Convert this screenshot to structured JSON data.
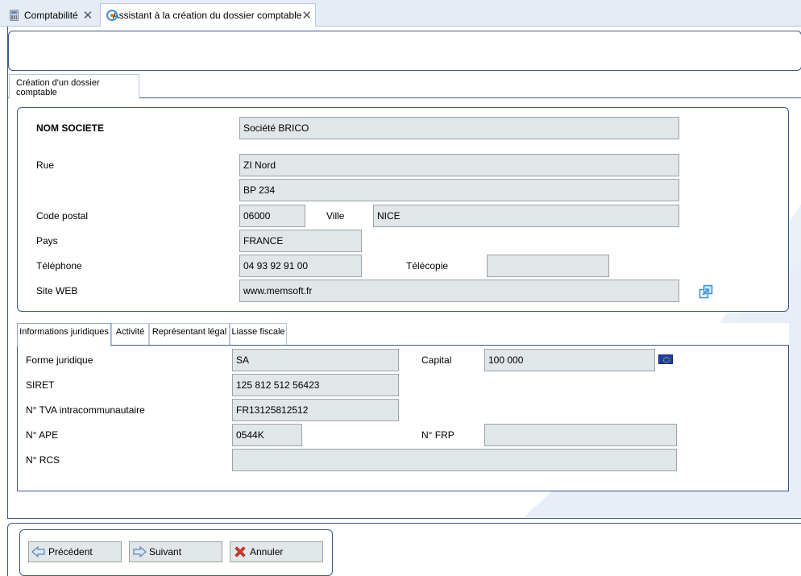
{
  "tabs": [
    {
      "label": "Comptabilité"
    },
    {
      "label": "Assistant à la création du dossier comptable",
      "close": "✕"
    }
  ],
  "section_tab": "Création d'un dossier comptable",
  "company": {
    "name_label": "NOM SOCIETE",
    "name_value": "Société BRICO",
    "rue_label": "Rue",
    "rue1_value": "ZI Nord",
    "rue2_value": "BP 234",
    "cp_label": "Code postal",
    "cp_value": "06000",
    "ville_label": "Ville",
    "ville_value": "NICE",
    "pays_label": "Pays",
    "pays_value": "FRANCE",
    "tel_label": "Téléphone",
    "tel_value": "04 93 92 91 00",
    "fax_label": "Télécopie",
    "fax_value": "",
    "web_label": "Site WEB",
    "web_value": "www.memsoft.fr"
  },
  "inner_tabs": [
    "Informations juridiques",
    "Activité",
    "Représentant légal",
    "Liasse fiscale"
  ],
  "legal": {
    "forme_label": "Forme juridique",
    "forme_value": "SA",
    "capital_label": "Capital",
    "capital_value": "100 000",
    "siret_label": "SIRET",
    "siret_value": "125 812 512 56423",
    "tva_label": "N° TVA intracommunautaire",
    "tva_value": "FR13125812512",
    "ape_label": "N° APE",
    "ape_value": "0544K",
    "frp_label": "N° FRP",
    "frp_value": "",
    "rcs_label": "N° RCS",
    "rcs_value": ""
  },
  "buttons": {
    "prev": "Précédent",
    "next": "Suivant",
    "cancel": "Annuler"
  },
  "colors": {
    "accent_border": "#3a5a8a",
    "field_bg": "#e1e6e8",
    "tabstrip_bg": "#e6ecf5"
  },
  "icons": {
    "tab1": "calculator-icon",
    "tab2": "wizard-icon",
    "web": "open-link-icon",
    "capital": "euro-flag-icon",
    "prev": "arrow-left-icon",
    "next": "arrow-right-icon",
    "cancel": "red-x-icon"
  }
}
